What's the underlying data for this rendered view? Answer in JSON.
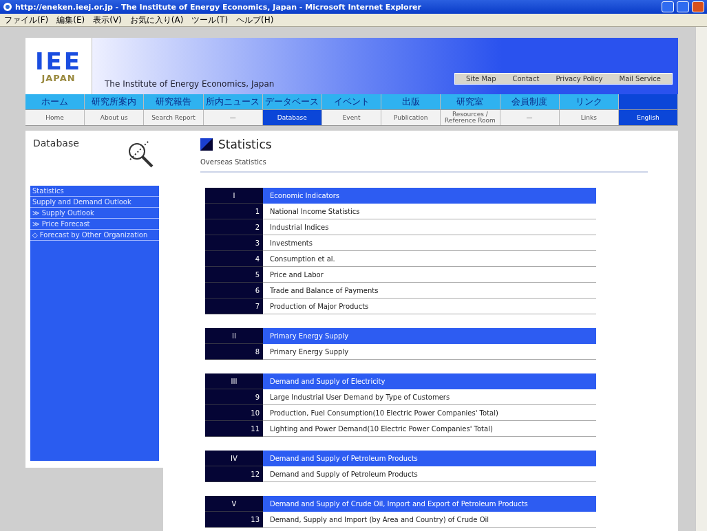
{
  "window": {
    "title": "http://eneken.ieej.or.jp - The Institute of Energy Economics, Japan - Microsoft Internet Explorer"
  },
  "menu": [
    "ファイル(F)",
    "編集(E)",
    "表示(V)",
    "お気に入り(A)",
    "ツール(T)",
    "ヘルプ(H)"
  ],
  "header": {
    "logo_top": "IEE",
    "logo_bottom": "JAPAN",
    "org_name": "The Institute of Energy Economics, Japan",
    "top_links": [
      "Site Map",
      "Contact",
      "Privacy Policy",
      "Mail Service"
    ]
  },
  "nav_jp": [
    {
      "label": "ホーム",
      "selected": false
    },
    {
      "label": "研究所案内",
      "selected": false
    },
    {
      "label": "研究報告",
      "selected": false
    },
    {
      "label": "所内ニュース",
      "selected": false
    },
    {
      "label": "データベース",
      "selected": false
    },
    {
      "label": "イベント",
      "selected": false
    },
    {
      "label": "出版",
      "selected": false
    },
    {
      "label": "研究室",
      "selected": false
    },
    {
      "label": "会員制度",
      "selected": false
    },
    {
      "label": "リンク",
      "selected": false
    },
    {
      "selected": true
    }
  ],
  "nav_en": [
    {
      "label": "Home",
      "selected": false
    },
    {
      "label": "About us",
      "selected": false
    },
    {
      "label": "Search Report",
      "selected": false
    },
    {
      "label": "—",
      "selected": false
    },
    {
      "label": "Database",
      "selected": true
    },
    {
      "label": "Event",
      "selected": false
    },
    {
      "label": "Publication",
      "selected": false
    },
    {
      "label": "Resources / Reference Room",
      "selected": false
    },
    {
      "label": "—",
      "selected": false
    },
    {
      "label": "Links",
      "selected": false
    },
    {
      "label": "English",
      "selected": true
    }
  ],
  "sidebar": {
    "title": "Database",
    "items": [
      "Statistics",
      "Supply and Demand Outlook",
      "≫ Supply Outlook",
      "≫ Price Forecast",
      "◇ Forecast by Other Organization"
    ]
  },
  "main": {
    "title": "Statistics",
    "breadcrumb": "Overseas Statistics",
    "sections": [
      {
        "numeral": "I",
        "title": "Economic Indicators",
        "items": [
          {
            "no": "1",
            "label": "National Income Statistics"
          },
          {
            "no": "2",
            "label": "Industrial Indices"
          },
          {
            "no": "3",
            "label": "Investments"
          },
          {
            "no": "4",
            "label": "Consumption et al."
          },
          {
            "no": "5",
            "label": "Price and Labor"
          },
          {
            "no": "6",
            "label": "Trade and Balance of Payments"
          },
          {
            "no": "7",
            "label": "Production of Major Products"
          }
        ]
      },
      {
        "numeral": "II",
        "title": "Primary Energy Supply",
        "items": [
          {
            "no": "8",
            "label": "Primary Energy Supply"
          }
        ]
      },
      {
        "numeral": "III",
        "title": "Demand and Supply of Electricity",
        "items": [
          {
            "no": "9",
            "label": "Large Industrial User Demand by Type of Customers"
          },
          {
            "no": "10",
            "label": "Production, Fuel Consumption(10 Electric Power Companies' Total)"
          },
          {
            "no": "11",
            "label": "Lighting and Power Demand(10 Electric Power Companies' Total)"
          }
        ]
      },
      {
        "numeral": "IV",
        "title": "Demand and Supply of Petroleum Products",
        "items": [
          {
            "no": "12",
            "label": "Demand and Supply of Petroleum Products"
          }
        ]
      },
      {
        "numeral": "V",
        "title": "Demand and Supply of Crude Oil, Import and Export of Petroleum Products",
        "items": [
          {
            "no": "13",
            "label": "Demand, Supply and Import (by Area and Country) of Crude Oil"
          }
        ]
      }
    ]
  }
}
